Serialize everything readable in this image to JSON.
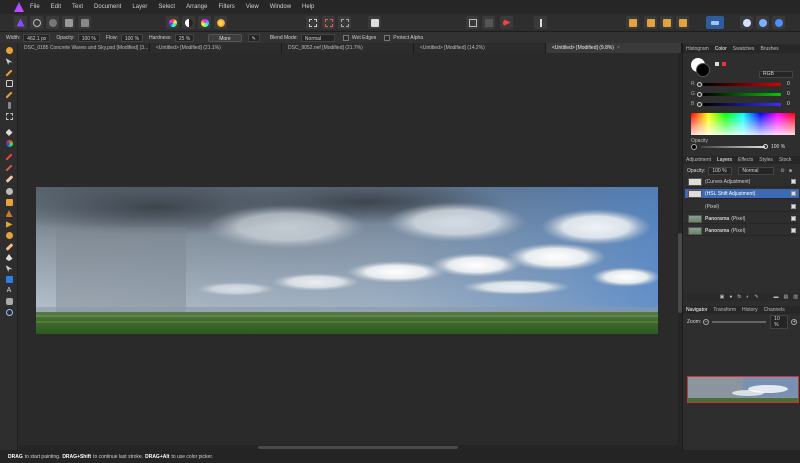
{
  "menubar": {
    "items": [
      "File",
      "Edit",
      "Text",
      "Document",
      "Layer",
      "Select",
      "Arrange",
      "Filters",
      "View",
      "Window",
      "Help"
    ]
  },
  "toolbar": {
    "icons": [
      "persona-photo-icon",
      "persona-liquify-icon",
      "persona-develop-icon",
      "persona-tone-icon",
      "persona-export-icon",
      "histogram-icon",
      "contrast-icon",
      "color-wheel-icon",
      "color-balance-icon",
      "selection-icon",
      "deselect-icon",
      "mask-icon",
      "quick-mask-icon",
      "refine-icon",
      "snapping-icon",
      "assistant-icon",
      "arrange-back-icon",
      "arrange-forward-icon",
      "arrange-front-icon",
      "arrange-bottom-icon",
      "align-icon",
      "studio-icon-1",
      "studio-icon-2",
      "studio-icon-3"
    ]
  },
  "context": {
    "width_label": "Width:",
    "width_value": "462.1 px",
    "opacity_label": "Opacity:",
    "opacity_value": "100 %",
    "flow_label": "Flow:",
    "flow_value": "100 %",
    "hardness_label": "Hardness:",
    "hardness_value": "25 %",
    "more_label": "More",
    "blend_label": "Blend Mode:",
    "blend_value": "Normal",
    "wet_edges": "Wet Edges",
    "protect_alpha": "Protect Alpha"
  },
  "doc_tabs": [
    {
      "label": "DSC_0185 Concrete Waves and Sky.psd [Modified] (3...",
      "active": false
    },
    {
      "label": "<Untitled> [Modified] (21.1%)",
      "active": false
    },
    {
      "label": "DSC_9052.nef [Modified] (21.7%)",
      "active": false
    },
    {
      "label": "<Untitled> [Modified] (14.2%)",
      "active": false
    },
    {
      "label": "<Untitled> [Modified] (9.8%)",
      "active": true
    }
  ],
  "status": {
    "text1": "DRAG",
    "text2": " to start painting. ",
    "text3": "DRAG+Shift",
    "text4": " to continue last stroke. ",
    "text5": "DRAG+Alt",
    "text6": " to use color picker."
  },
  "color_panel": {
    "tabs": [
      "Histogram",
      "Color",
      "Swatches",
      "Brushes"
    ],
    "active_tab": "Color",
    "mode": "RGB",
    "r_label": "R",
    "g_label": "G",
    "b_label": "B",
    "r_value": "0",
    "g_value": "0",
    "b_value": "0",
    "opacity_label": "Opacity",
    "opacity_value": "100 %"
  },
  "layers_panel": {
    "tabs": [
      "Adjustment",
      "Layers",
      "Effects",
      "Styles",
      "Stock"
    ],
    "active_tab": "Layers",
    "opacity_label": "Opacity:",
    "opacity_value": "100 %",
    "blend_value": "Normal",
    "layers": [
      {
        "name": "(Curves Adjustment)",
        "selected": false
      },
      {
        "name": "(HSL Shift Adjustment)",
        "selected": true
      },
      {
        "name": "(Pixel)",
        "selected": false
      },
      {
        "name": "Panorama",
        "suffix": "(Pixel)",
        "selected": false
      },
      {
        "name": "Panorama",
        "suffix": "(Pixel)",
        "selected": false
      }
    ]
  },
  "navigator_panel": {
    "tabs": [
      "Navigator",
      "Transform",
      "History",
      "Channels"
    ],
    "active_tab": "Navigator",
    "zoom_label": "Zoom:",
    "zoom_value": "10 %"
  },
  "colors": {
    "accent": "#3d6bb3",
    "background": "#2b2b2b"
  }
}
